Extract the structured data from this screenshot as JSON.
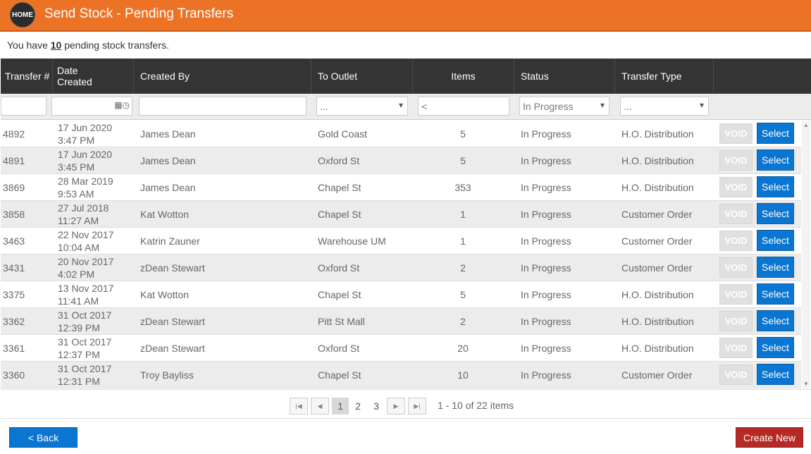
{
  "header": {
    "home_label": "HOME",
    "title": "Send Stock - Pending Transfers",
    "accent_color": "#ec7325"
  },
  "summary": {
    "prefix": "You have ",
    "count": "10",
    "suffix": " pending stock transfers."
  },
  "columns": {
    "transfer": "Transfer #",
    "date": "Date Created",
    "created_by": "Created By",
    "to_outlet": "To Outlet",
    "items": "Items",
    "status": "Status",
    "transfer_type": "Transfer Type"
  },
  "filters": {
    "outlet": "...",
    "items": "<",
    "status": "In Progress",
    "type": "..."
  },
  "rows": [
    {
      "id": "4892",
      "date": "17 Jun 2020",
      "time": "3:47 PM",
      "created_by": "James Dean",
      "outlet": "Gold Coast",
      "items": "5",
      "status": "In Progress",
      "type": "H.O. Distribution"
    },
    {
      "id": "4891",
      "date": "17 Jun 2020",
      "time": "3:45 PM",
      "created_by": "James Dean",
      "outlet": "Oxford St",
      "items": "5",
      "status": "In Progress",
      "type": "H.O. Distribution"
    },
    {
      "id": "3869",
      "date": "28 Mar 2019",
      "time": "9:53 AM",
      "created_by": "James Dean",
      "outlet": "Chapel St",
      "items": "353",
      "status": "In Progress",
      "type": "H.O. Distribution"
    },
    {
      "id": "3858",
      "date": "27 Jul 2018",
      "time": "11:27 AM",
      "created_by": "Kat Wotton",
      "outlet": "Chapel St",
      "items": "1",
      "status": "In Progress",
      "type": "Customer Order"
    },
    {
      "id": "3463",
      "date": "22 Nov 2017",
      "time": "10:04 AM",
      "created_by": "Katrin Zauner",
      "outlet": "Warehouse UM",
      "items": "1",
      "status": "In Progress",
      "type": "Customer Order"
    },
    {
      "id": "3431",
      "date": "20 Nov 2017",
      "time": "4:02 PM",
      "created_by": "zDean Stewart",
      "outlet": "Oxford St",
      "items": "2",
      "status": "In Progress",
      "type": "Customer Order"
    },
    {
      "id": "3375",
      "date": "13 Nov 2017",
      "time": "11:41 AM",
      "created_by": "Kat Wotton",
      "outlet": "Chapel St",
      "items": "5",
      "status": "In Progress",
      "type": "H.O. Distribution"
    },
    {
      "id": "3362",
      "date": "31 Oct 2017",
      "time": "12:39 PM",
      "created_by": "zDean Stewart",
      "outlet": "Pitt St Mall",
      "items": "2",
      "status": "In Progress",
      "type": "H.O. Distribution"
    },
    {
      "id": "3361",
      "date": "31 Oct 2017",
      "time": "12:37 PM",
      "created_by": "zDean Stewart",
      "outlet": "Oxford St",
      "items": "20",
      "status": "In Progress",
      "type": "H.O. Distribution"
    },
    {
      "id": "3360",
      "date": "31 Oct 2017",
      "time": "12:31 PM",
      "created_by": "Troy Bayliss",
      "outlet": "Chapel St",
      "items": "10",
      "status": "In Progress",
      "type": "Customer Order"
    }
  ],
  "row_actions": {
    "void": "VOID",
    "select": "Select"
  },
  "pager": {
    "pages": [
      "1",
      "2",
      "3"
    ],
    "current": "1",
    "info": "1 - 10 of 22 items"
  },
  "footer": {
    "back": "< Back",
    "create_new": "Create New"
  }
}
